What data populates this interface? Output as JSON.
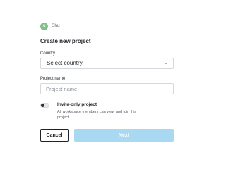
{
  "workspace": {
    "avatar_initial": "S",
    "name": "Shu",
    "avatar_color": "#7fbf8e"
  },
  "form": {
    "title": "Create new project",
    "country": {
      "label": "Country",
      "value": "Select country"
    },
    "project_name": {
      "label": "Project name",
      "placeholder": "Project name",
      "value": ""
    },
    "invite_only": {
      "title": "Invite-only project",
      "description": "All workspace members can view and join this project.",
      "enabled": false
    }
  },
  "actions": {
    "cancel_label": "Cancel",
    "next_label": "Next",
    "next_disabled": true
  },
  "colors": {
    "next_button": "#a9d9f2",
    "border": "#d5d9de",
    "text": "#1f2328"
  },
  "icons": {
    "country_select": "chevron-down-icon"
  }
}
